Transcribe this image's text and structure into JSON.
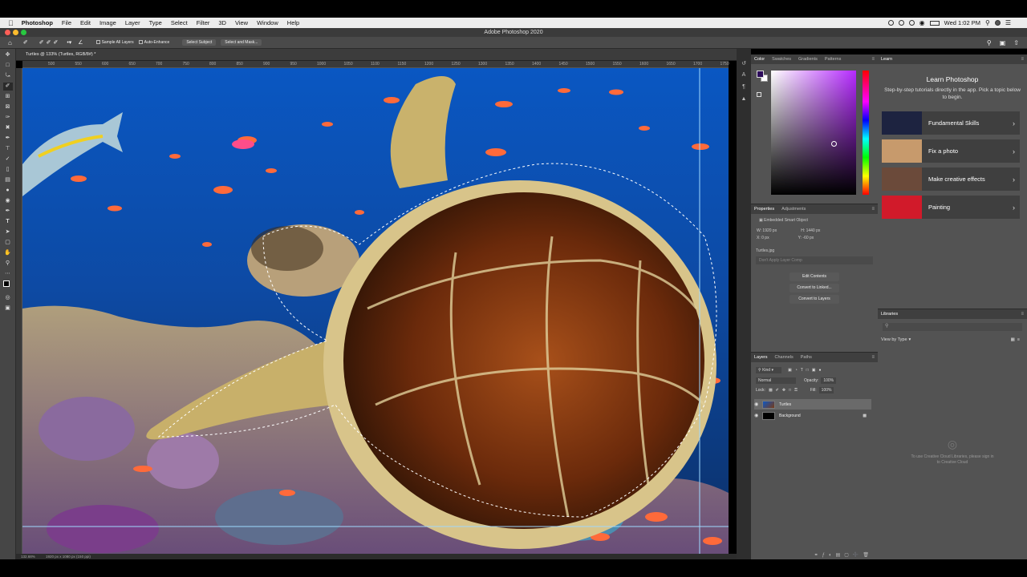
{
  "menubar": {
    "app": "Photoshop",
    "items": [
      "File",
      "Edit",
      "Image",
      "Layer",
      "Type",
      "Select",
      "Filter",
      "3D",
      "View",
      "Window",
      "Help"
    ],
    "clock": "Wed 1:02 PM"
  },
  "window": {
    "title": "Adobe Photoshop 2020"
  },
  "options_bar": {
    "sample_all_layers": "Sample All Layers",
    "auto_enhance": "Auto-Enhance",
    "select_subject": "Select Subject",
    "select_and_mask": "Select and Mask..."
  },
  "document": {
    "tab_title": "Turtles @ 133% (Turtles, RGB/8#) *"
  },
  "ruler_ticks": [
    "500",
    "550",
    "600",
    "650",
    "700",
    "750",
    "800",
    "850",
    "900",
    "950",
    "1000",
    "1050",
    "1100",
    "1150",
    "1200",
    "1250",
    "1300",
    "1350",
    "1400",
    "1450",
    "1500",
    "1550",
    "1600",
    "1650",
    "1700",
    "1750"
  ],
  "status": {
    "zoom": "132.68%",
    "doc_size": "1920 px x 1080 px (150 ppi)"
  },
  "color_panel": {
    "tabs": [
      "Color",
      "Swatches",
      "Gradients",
      "Patterns"
    ],
    "accent_hue": "#b52aff"
  },
  "properties_panel": {
    "tabs": [
      "Properties",
      "Adjustments"
    ],
    "type": "Embedded Smart Object",
    "w": "W: 1920 px",
    "h": "H: 1440 px",
    "x": "X: 0 px",
    "y": "Y: -60 px",
    "filename": "Turtles.jpg",
    "layer_comp": "Don't Apply Layer Comp",
    "buttons": [
      "Edit Contents",
      "Convert to Linked...",
      "Convert to Layers"
    ]
  },
  "layers_panel": {
    "tabs": [
      "Layers",
      "Channels",
      "Paths"
    ],
    "kind": "Kind",
    "blend": "Normal",
    "opacity_label": "Opacity:",
    "opacity": "100%",
    "lock_label": "Lock:",
    "fill_label": "Fill:",
    "fill": "100%",
    "layers": [
      {
        "name": "Turtles",
        "selected": true
      },
      {
        "name": "Background",
        "selected": false
      }
    ]
  },
  "learn_panel": {
    "tab": "Learn",
    "heading": "Learn Photoshop",
    "subtitle": "Step-by-step tutorials directly in the app. Pick a topic below to begin.",
    "items": [
      {
        "label": "Fundamental Skills",
        "color": "#1d2340"
      },
      {
        "label": "Fix a photo",
        "color": "#c79a6c"
      },
      {
        "label": "Make creative effects",
        "color": "#6b4a3a"
      },
      {
        "label": "Painting",
        "color": "#d11a2a"
      }
    ]
  },
  "libraries_panel": {
    "tab": "Libraries",
    "view_by": "View by Type",
    "signin": "To use Creative Cloud Libraries, please sign in to Creative Cloud"
  }
}
